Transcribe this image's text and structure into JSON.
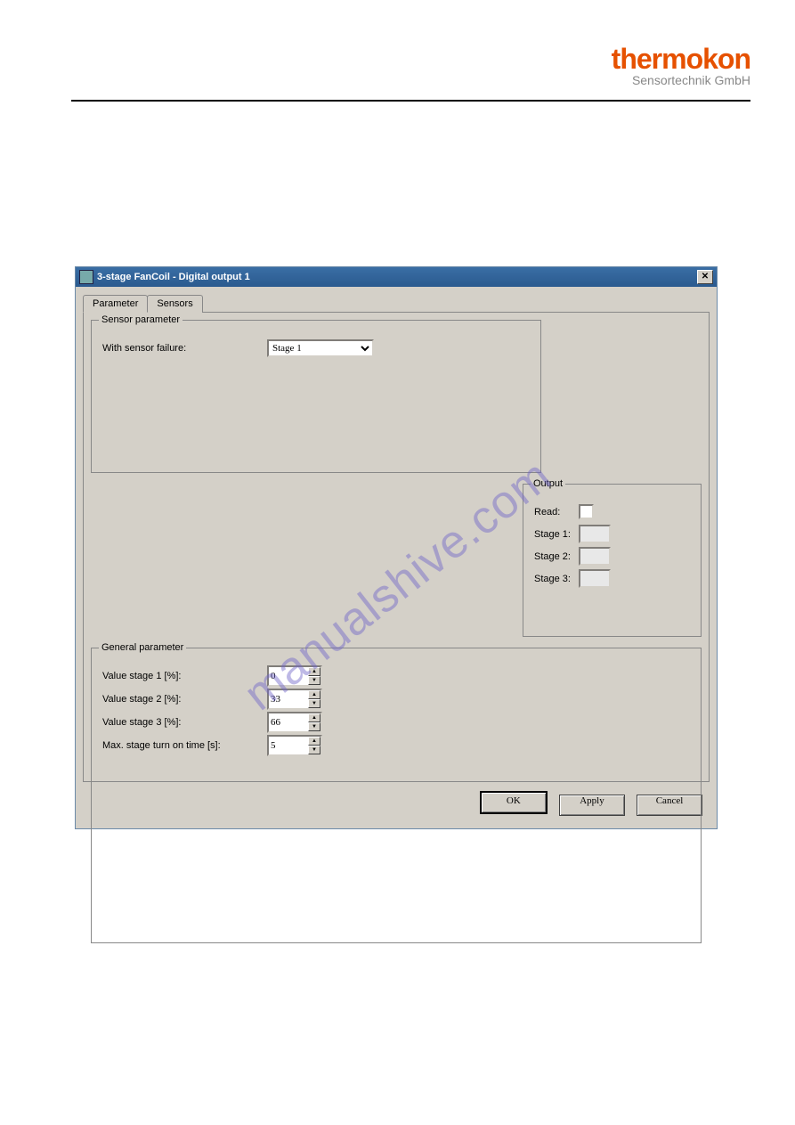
{
  "brand": {
    "name": "thermokon",
    "subtitle": "Sensortechnik GmbH"
  },
  "watermark": "manualshive.com",
  "dialog": {
    "title": "3-stage FanCoil - Digital output 1",
    "tabs": [
      "Parameter",
      "Sensors"
    ],
    "sensor_parameter": {
      "legend": "Sensor parameter",
      "with_sensor_failure_label": "With sensor failure:",
      "with_sensor_failure_value": "Stage 1"
    },
    "output": {
      "legend": "Output",
      "read_label": "Read:",
      "stage1_label": "Stage 1:",
      "stage2_label": "Stage 2:",
      "stage3_label": "Stage 3:"
    },
    "general_parameter": {
      "legend": "General parameter",
      "rows": [
        {
          "label": "Value stage 1 [%]:",
          "value": "0"
        },
        {
          "label": "Value stage 2 [%]:",
          "value": "33"
        },
        {
          "label": "Value stage 3 [%]:",
          "value": "66"
        },
        {
          "label": "Max. stage turn on time [s]:",
          "value": "5"
        }
      ]
    },
    "buttons": {
      "ok": "OK",
      "apply": "Apply",
      "cancel": "Cancel"
    }
  }
}
